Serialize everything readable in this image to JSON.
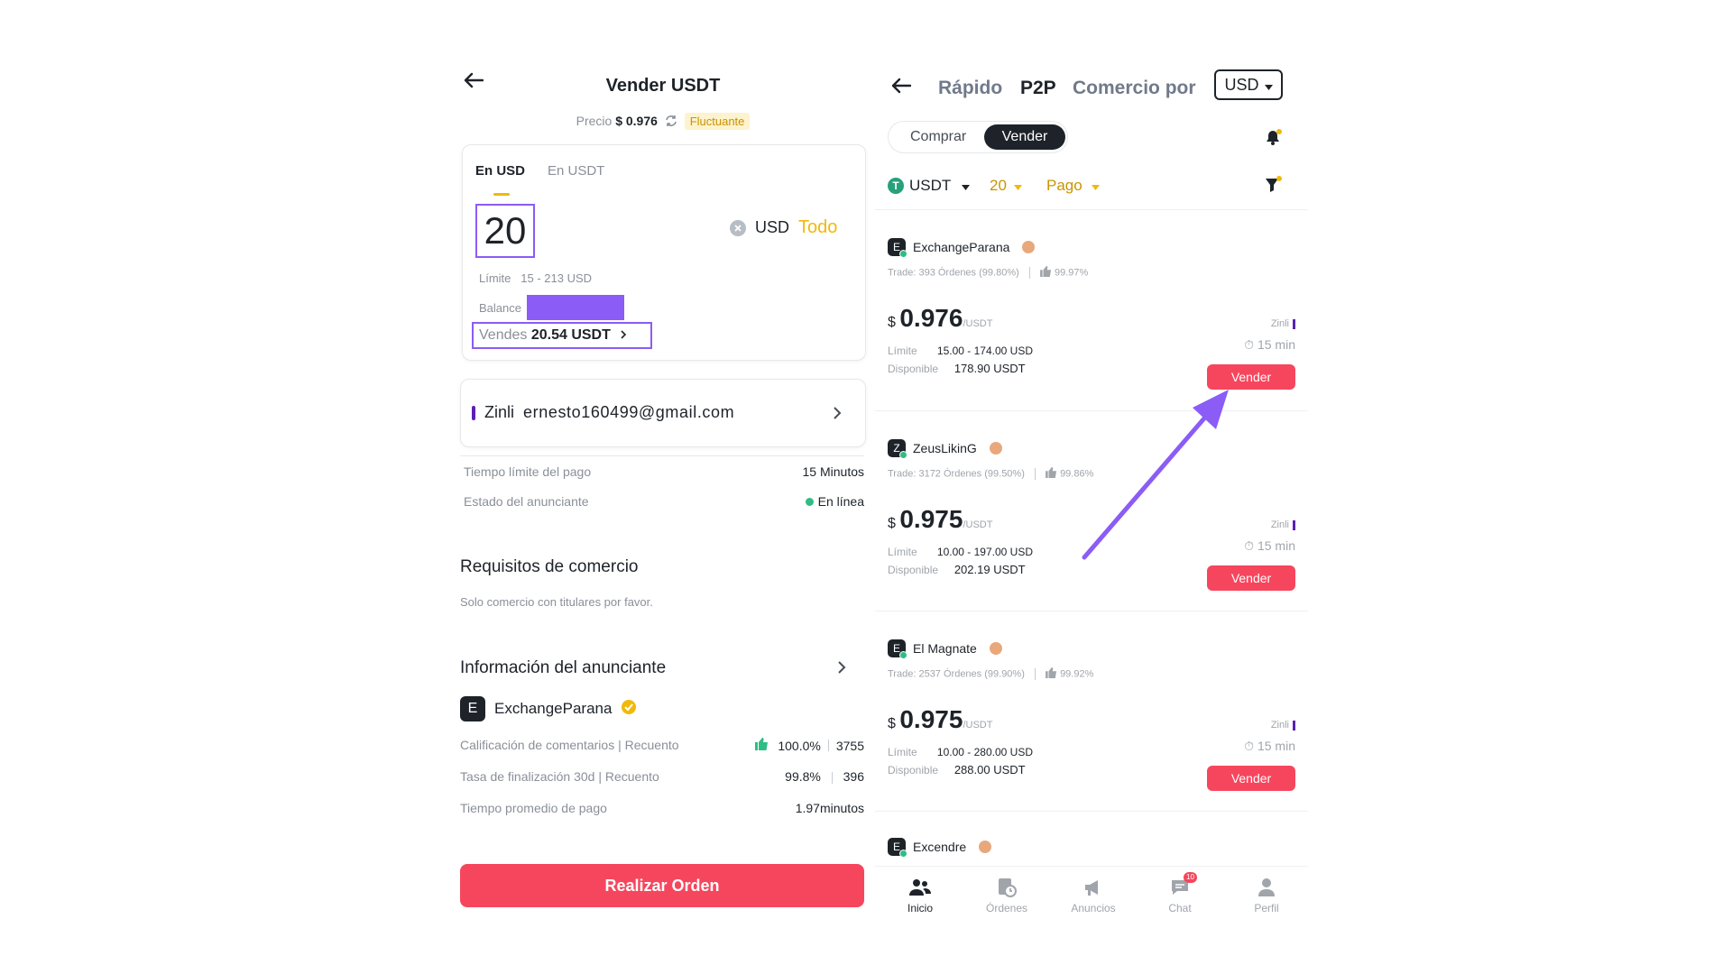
{
  "left": {
    "title": "Vender USDT",
    "price_label": "Precio",
    "price_value": "$ 0.976",
    "price_badge": "Fluctuante",
    "tabs": [
      "En USD",
      "En USDT"
    ],
    "amount_value": "20",
    "currency": "USD",
    "all_label": "Todo",
    "limit_label": "Límite",
    "limit_value": "15 - 213 USD",
    "balance_label": "Balance",
    "sell_label": "Vendes",
    "sell_value": "20.54 USDT",
    "payment_method": "Zinli",
    "payment_account": "ernesto160499@gmail.com",
    "details": [
      {
        "label": "Tiempo límite del pago",
        "value": "15 Minutos"
      },
      {
        "label": "Estado del anunciante",
        "value": "En línea"
      }
    ],
    "terms_title": "Requisitos de comercio",
    "terms_text": "Solo comercio con titulares por favor.",
    "advertiser_title": "Información del anunciante",
    "advertiser_initial": "E",
    "advertiser_name": "ExchangeParana",
    "stats": [
      {
        "label": "Calificación de comentarios | Recuento",
        "value1": "100.0%",
        "value2": "3755"
      },
      {
        "label": "Tasa de finalización 30d | Recuento",
        "value1": "99.8%",
        "value2": "396"
      },
      {
        "label": "Tiempo promedio de pago",
        "value1": "1.97minutos",
        "value2": ""
      }
    ],
    "order_button": "Realizar Orden"
  },
  "right": {
    "tabs": [
      "Rápido",
      "P2P",
      "Comercio por"
    ],
    "currency_select": "USD",
    "toggle": [
      "Comprar",
      "Vender"
    ],
    "filters": {
      "asset": "USDT",
      "amount": "20",
      "payment": "Pago"
    },
    "offers": [
      {
        "initial": "E",
        "name": "ExchangeParana",
        "trade_label": "Trade:",
        "orders": "393 Órdenes",
        "completion": "(99.80%)",
        "rating": "99.97%",
        "currency_symbol": "$",
        "price": "0.976",
        "unit": "/USDT",
        "limit_label": "Límite",
        "limit": "15.00 - 174.00 USD",
        "avail_label": "Disponible",
        "available": "178.90 USDT",
        "method": "Zinli",
        "time": "15 min",
        "button": "Vender"
      },
      {
        "initial": "Z",
        "name": "ZeusLikinG",
        "trade_label": "Trade:",
        "orders": "3172 Órdenes",
        "completion": "(99.50%)",
        "rating": "99.86%",
        "currency_symbol": "$",
        "price": "0.975",
        "unit": "/USDT",
        "limit_label": "Límite",
        "limit": "10.00 - 197.00 USD",
        "avail_label": "Disponible",
        "available": "202.19 USDT",
        "method": "Zinli",
        "time": "15 min",
        "button": "Vender"
      },
      {
        "initial": "E",
        "name": "El Magnate",
        "trade_label": "Trade:",
        "orders": "2537 Órdenes",
        "completion": "(99.90%)",
        "rating": "99.92%",
        "currency_symbol": "$",
        "price": "0.975",
        "unit": "/USDT",
        "limit_label": "Límite",
        "limit": "10.00 - 280.00 USD",
        "avail_label": "Disponible",
        "available": "288.00 USDT",
        "method": "Zinli",
        "time": "15 min",
        "button": "Vender"
      }
    ],
    "partial_offer": {
      "initial": "E",
      "name": "Excendre"
    },
    "nav": [
      "Inicio",
      "Órdenes",
      "Anuncios",
      "Chat",
      "Perfil"
    ],
    "chat_badge": "10"
  },
  "colors": {
    "accent_yellow": "#f0b90b",
    "sell_red": "#f6465d",
    "highlight_purple": "#8b5cf6",
    "online_green": "#2ebd85"
  }
}
